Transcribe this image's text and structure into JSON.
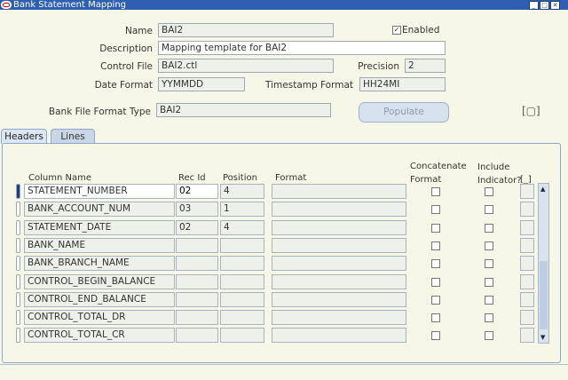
{
  "window": {
    "title": "Bank Statement Mapping",
    "buttons": [
      "minimize",
      "maximize",
      "close"
    ]
  },
  "form": {
    "name_label": "Name",
    "name_value": "BAI2",
    "enabled_label": "Enabled",
    "enabled_checked": true,
    "description_label": "Description",
    "description_value": "Mapping template for BAI2",
    "control_file_label": "Control File",
    "control_file_value": "BAI2.ctl",
    "precision_label": "Precision",
    "precision_value": "2",
    "date_format_label": "Date Format",
    "date_format_value": "YYMMDD",
    "timestamp_format_label": "Timestamp Format",
    "timestamp_format_value": "HH24MI",
    "bank_file_format_type_label": "Bank File Format Type",
    "bank_file_format_type_value": "BAI2",
    "populate_label": "Populate"
  },
  "tabs": [
    {
      "label": "Headers",
      "active": true
    },
    {
      "label": "Lines",
      "active": false
    }
  ],
  "grid": {
    "headers": {
      "column_name": "Column Name",
      "rec_id": "Rec Id",
      "position": "Position",
      "format": "Format",
      "concatenate_1": "Concatenate",
      "concatenate_2": "Format",
      "include_1": "Include",
      "include_2": "Indicator?"
    },
    "rows": [
      {
        "column_name": "STATEMENT_NUMBER",
        "rec_id": "02",
        "position": "4",
        "format": ""
      },
      {
        "column_name": "BANK_ACCOUNT_NUM",
        "rec_id": "03",
        "position": "1",
        "format": ""
      },
      {
        "column_name": "STATEMENT_DATE",
        "rec_id": "02",
        "position": "4",
        "format": ""
      },
      {
        "column_name": "BANK_NAME",
        "rec_id": "",
        "position": "",
        "format": ""
      },
      {
        "column_name": "BANK_BRANCH_NAME",
        "rec_id": "",
        "position": "",
        "format": ""
      },
      {
        "column_name": "CONTROL_BEGIN_BALANCE",
        "rec_id": "",
        "position": "",
        "format": ""
      },
      {
        "column_name": "CONTROL_END_BALANCE",
        "rec_id": "",
        "position": "",
        "format": ""
      },
      {
        "column_name": "CONTROL_TOTAL_DR",
        "rec_id": "",
        "position": "",
        "format": ""
      },
      {
        "column_name": "CONTROL_TOTAL_CR",
        "rec_id": "",
        "position": "",
        "format": ""
      }
    ]
  },
  "colors": {
    "titlebar": "#2e5fb0",
    "background": "#f7f7e7",
    "selection": "#1c3b8c"
  }
}
